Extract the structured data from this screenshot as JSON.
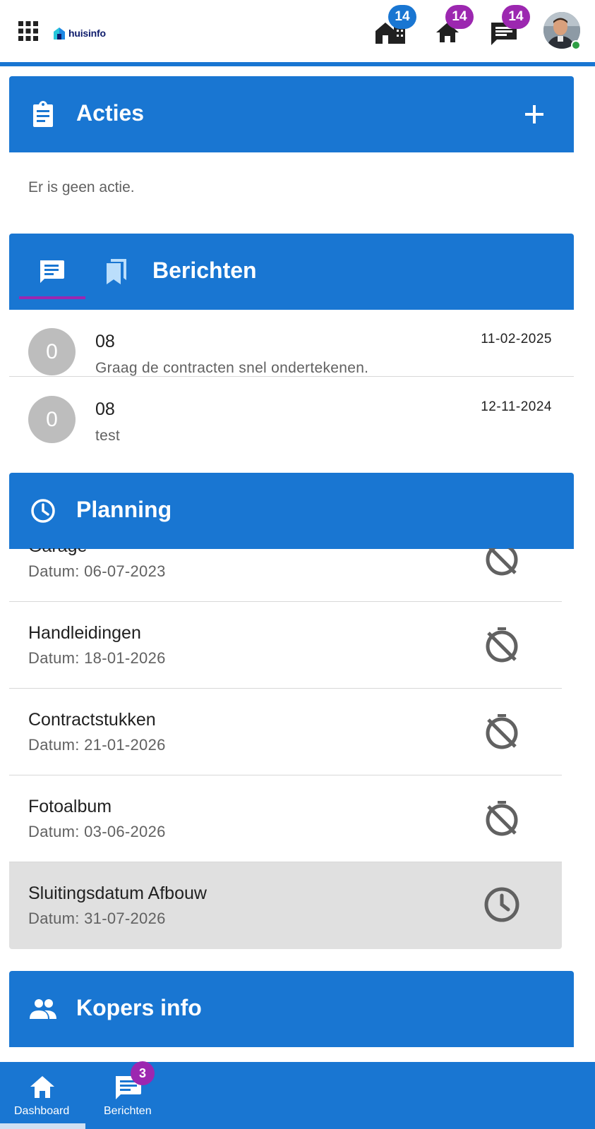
{
  "header": {
    "logo_text": "huisinfo",
    "badges": {
      "buildings": "14",
      "home": "14",
      "messages": "14"
    }
  },
  "acties": {
    "title": "Acties",
    "empty_text": "Er is geen actie."
  },
  "berichten": {
    "title": "Berichten",
    "messages": [
      {
        "avatar": "0",
        "title": "08",
        "text": "Graag de contracten snel ondertekenen.",
        "date": "11-02-2025"
      },
      {
        "avatar": "0",
        "title": "08",
        "text": "test",
        "date": "12-11-2024"
      }
    ]
  },
  "planning": {
    "title": "Planning",
    "items": [
      {
        "title": "Garage",
        "date": "Datum: 06-07-2023",
        "icon": "timer-off-icon"
      },
      {
        "title": "Handleidingen",
        "date": "Datum: 18-01-2026",
        "icon": "timer-off-icon"
      },
      {
        "title": "Contractstukken",
        "date": "Datum: 21-01-2026",
        "icon": "timer-off-icon"
      },
      {
        "title": "Fotoalbum",
        "date": "Datum: 03-06-2026",
        "icon": "timer-off-icon"
      },
      {
        "title": "Sluitingsdatum Afbouw",
        "date": "Datum: 31-07-2026",
        "icon": "clock-icon"
      }
    ]
  },
  "kopers": {
    "title": "Kopers info"
  },
  "bottom_nav": {
    "dashboard_label": "Dashboard",
    "berichten_label": "Berichten",
    "berichten_badge": "3"
  },
  "colors": {
    "primary": "#1976d2",
    "badge_purple": "#9c27b0",
    "online": "#2e9e44"
  }
}
